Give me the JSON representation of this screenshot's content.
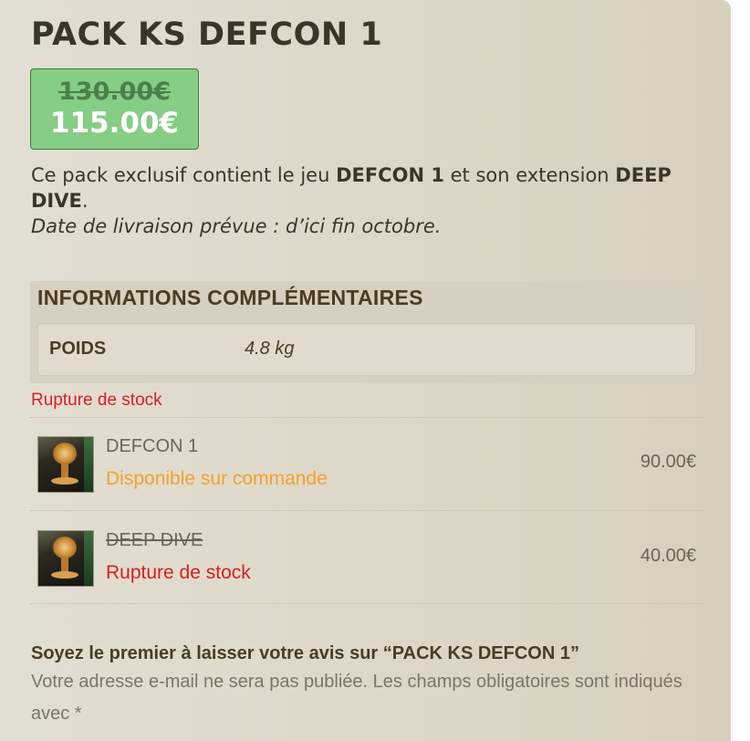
{
  "product": {
    "title": "PACK KS DEFCON 1",
    "price_old": "130.00€",
    "price_new": "115.00€"
  },
  "description": {
    "intro": "Ce pack exclusif contient le jeu ",
    "game_name": "DEFCON 1",
    "middle": " et son extension ",
    "extension_name": "DEEP DIVE",
    "end": ".",
    "delivery": "Date de livraison prévue : d’ici fin octobre."
  },
  "info": {
    "heading": "INFORMATIONS COMPLÉMENTAIRES",
    "rows": [
      {
        "label": "POIDS",
        "value": "4.8 kg"
      }
    ]
  },
  "stock_status": "Rupture de stock",
  "bundle_items": [
    {
      "name": "DEFCON 1",
      "status": "Disponible sur commande",
      "price": "90.00€",
      "icon": "boxed-game-thumbnail"
    },
    {
      "name": "DEEP DIVE",
      "status": "Rupture de stock",
      "price": "40.00€",
      "icon": "boxed-game-thumbnail"
    }
  ],
  "reviews": {
    "heading": "Soyez le premier à laisser votre avis sur “PACK KS DEFCON 1”",
    "note": "Votre adresse e-mail ne sera pas publiée. Les champs obligatoires sont indiqués avec *"
  },
  "colors": {
    "price_box_bg": "#86cd86",
    "out_of_stock": "#d61f1f",
    "on_order": "#f3a12b",
    "title_text": "#3b3528"
  }
}
